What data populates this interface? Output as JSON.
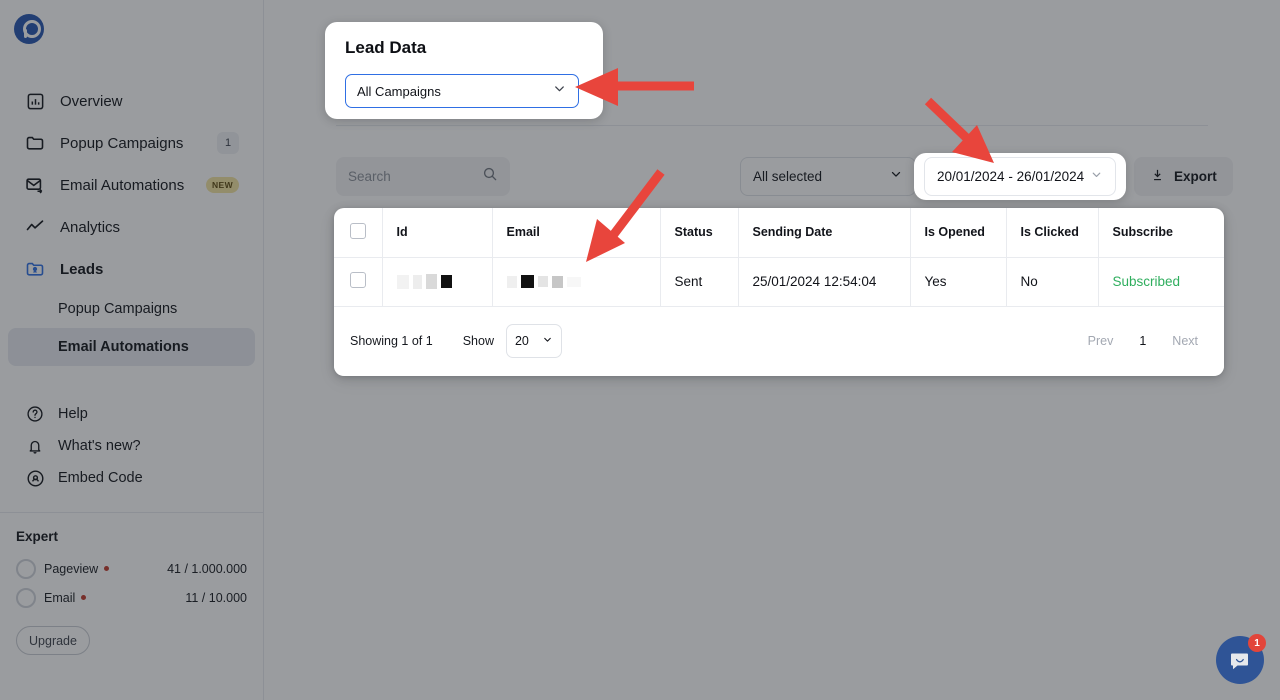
{
  "brand": {
    "logo_name": "popupsmart-logo",
    "accent": "#2555b0"
  },
  "sidebar": {
    "items": [
      {
        "label": "Overview",
        "icon": "chart-bar-icon"
      },
      {
        "label": "Popup Campaigns",
        "icon": "folder-icon",
        "count": "1"
      },
      {
        "label": "Email Automations",
        "icon": "mail-forward-icon",
        "badge": "NEW"
      },
      {
        "label": "Analytics",
        "icon": "trend-line-icon"
      },
      {
        "label": "Leads",
        "icon": "folder-user-icon"
      }
    ],
    "sub_items": [
      {
        "label": "Popup Campaigns",
        "active": false
      },
      {
        "label": "Email Automations",
        "active": true
      }
    ],
    "bottom_items": [
      {
        "label": "Help",
        "icon": "question-circle-icon"
      },
      {
        "label": "What's new?",
        "icon": "bell-icon"
      },
      {
        "label": "Embed Code",
        "icon": "embed-target-icon"
      }
    ],
    "plan": {
      "title": "Expert",
      "quotas": [
        {
          "name": "Pageview",
          "value": "41 / 1.000.000"
        },
        {
          "name": "Email",
          "value": "11 / 10.000"
        }
      ],
      "upgrade_label": "Upgrade"
    }
  },
  "lead_data_panel": {
    "title": "Lead Data",
    "campaign_select_value": "All Campaigns",
    "chevron_icon": "chevron-down-icon"
  },
  "toolbar": {
    "search_placeholder": "Search",
    "search_value": "",
    "search_icon": "search-icon",
    "selected_dropdown": "All selected",
    "date_range": "20/01/2024 - 26/01/2024",
    "export_label": "Export",
    "export_icon": "download-icon"
  },
  "table": {
    "columns": [
      "",
      "Id",
      "Email",
      "Status",
      "Sending Date",
      "Is Opened",
      "Is Clicked",
      "Subscribe"
    ],
    "rows": [
      {
        "id": "[redacted]",
        "email": "[redacted]",
        "status": "Sent",
        "sending_date": "25/01/2024 12:54:04",
        "is_opened": "Yes",
        "is_clicked": "No",
        "subscribe": "Subscribed",
        "subscribe_color": "#2fae5e"
      }
    ],
    "footer": {
      "showing": "Showing 1 of 1",
      "show_label": "Show",
      "page_size": "20",
      "prev": "Prev",
      "current_page": "1",
      "next": "Next"
    }
  },
  "annotations": {
    "arrow_color": "#e8453c",
    "arrows": [
      {
        "name": "arrow-to-campaign-select",
        "points_to": "All Campaigns dropdown"
      },
      {
        "name": "arrow-to-email-column",
        "points_to": "Email column"
      },
      {
        "name": "arrow-to-date-range",
        "points_to": "20/01/2024 - 26/01/2024 date picker"
      }
    ]
  },
  "chat_widget": {
    "name": "intercom-chat-launcher",
    "unread": "1",
    "color": "#2f5496"
  }
}
